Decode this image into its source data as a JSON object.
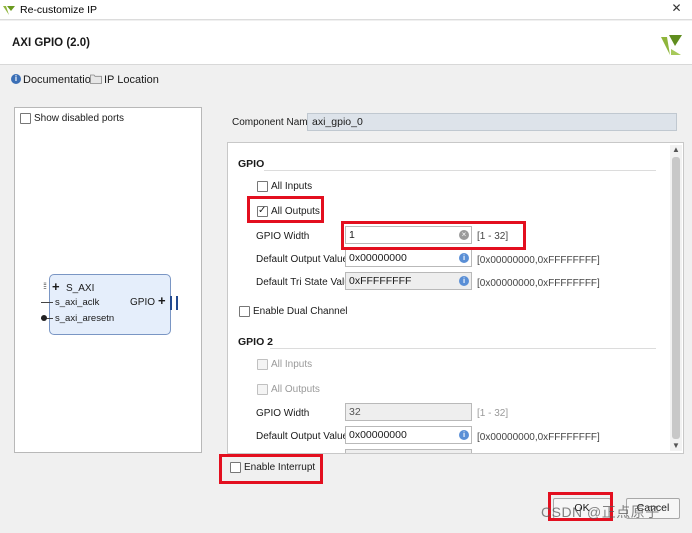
{
  "window": {
    "title": "Re-customize IP"
  },
  "header": {
    "ip_name": "AXI GPIO (2.0)"
  },
  "links": {
    "documentation": "Documentation",
    "ip_location": "IP Location"
  },
  "left_panel": {
    "show_disabled_ports": "Show disabled ports",
    "block": {
      "port_s_axi": "S_AXI",
      "port_aclk": "s_axi_aclk",
      "port_aresetn": "s_axi_aresetn",
      "port_gpio": "GPIO"
    }
  },
  "component_name": {
    "label": "Component Name",
    "value": "axi_gpio_0"
  },
  "gpio": {
    "title": "GPIO",
    "all_inputs": {
      "label": "All Inputs",
      "checked": false
    },
    "all_outputs": {
      "label": "All Outputs",
      "checked": true
    },
    "width": {
      "label": "GPIO Width",
      "value": "1",
      "range": "[1 - 32]"
    },
    "default_output": {
      "label": "Default Output Value",
      "value": "0x00000000",
      "range": "[0x00000000,0xFFFFFFFF]"
    },
    "default_tri": {
      "label": "Default Tri State Value",
      "value": "0xFFFFFFFF",
      "range": "[0x00000000,0xFFFFFFFF]"
    }
  },
  "dual_channel": {
    "label": "Enable Dual Channel",
    "checked": false
  },
  "gpio2": {
    "title": "GPIO 2",
    "all_inputs": {
      "label": "All Inputs"
    },
    "all_outputs": {
      "label": "All Outputs"
    },
    "width": {
      "label": "GPIO Width",
      "value": "32",
      "range": "[1 - 32]"
    },
    "default_output": {
      "label": "Default Output Value",
      "value": "0x00000000",
      "range": "[0x00000000,0xFFFFFFFF]"
    }
  },
  "interrupt": {
    "label": "Enable Interrupt",
    "checked": false
  },
  "buttons": {
    "ok": "OK",
    "cancel": "Cancel"
  },
  "watermark": "CSDN @正点原子",
  "colors": {
    "highlight": "#e30f1f",
    "block_fill": "#e5eefb",
    "info": "#5a8fd6"
  }
}
